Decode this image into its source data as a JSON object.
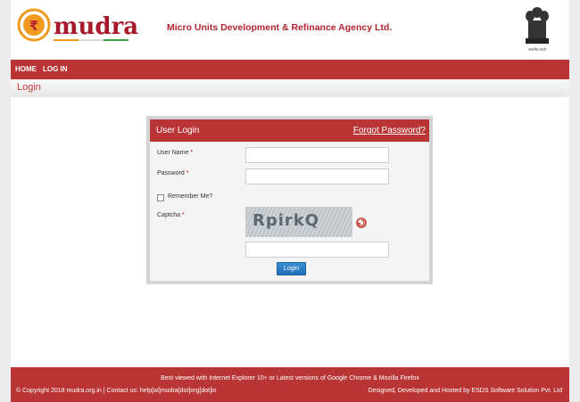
{
  "header": {
    "logo_text": "mudra",
    "agency_name": "Micro Units Development & Refinance Agency Ltd.",
    "emblem_caption": "सत्यमेव जयते"
  },
  "nav": {
    "items": [
      "HOME",
      "LOG IN"
    ]
  },
  "page_title": "Login",
  "login": {
    "title": "User Login",
    "forgot_link": "Forgot Password?",
    "username_label": "User Name",
    "password_label": "Password",
    "required_mark": "*",
    "remember_label": "Remember Me?",
    "remember_checked": false,
    "captcha_label": "Captcha",
    "captcha_text": "RpirkQ",
    "username_value": "",
    "password_value": "",
    "captcha_value": "",
    "submit_label": "Login"
  },
  "footer": {
    "browser_note": "Best viewed with Internet Explorer 10+ or Latest versions of Google Chrome & Mozilla Firefox",
    "copyright": "© Copyright 2018 mudra.org.in | Contact us: help[at]mudra[dot]org[dot]in",
    "credits": "Designed, Developed and Hosted by ESDS Software Solution Pvt. Ltd"
  },
  "colors": {
    "brand_red": "#b93535",
    "agency_text": "#b3232e",
    "button_blue": "#1f6fb8",
    "logo_orange": "#f29a1f"
  }
}
